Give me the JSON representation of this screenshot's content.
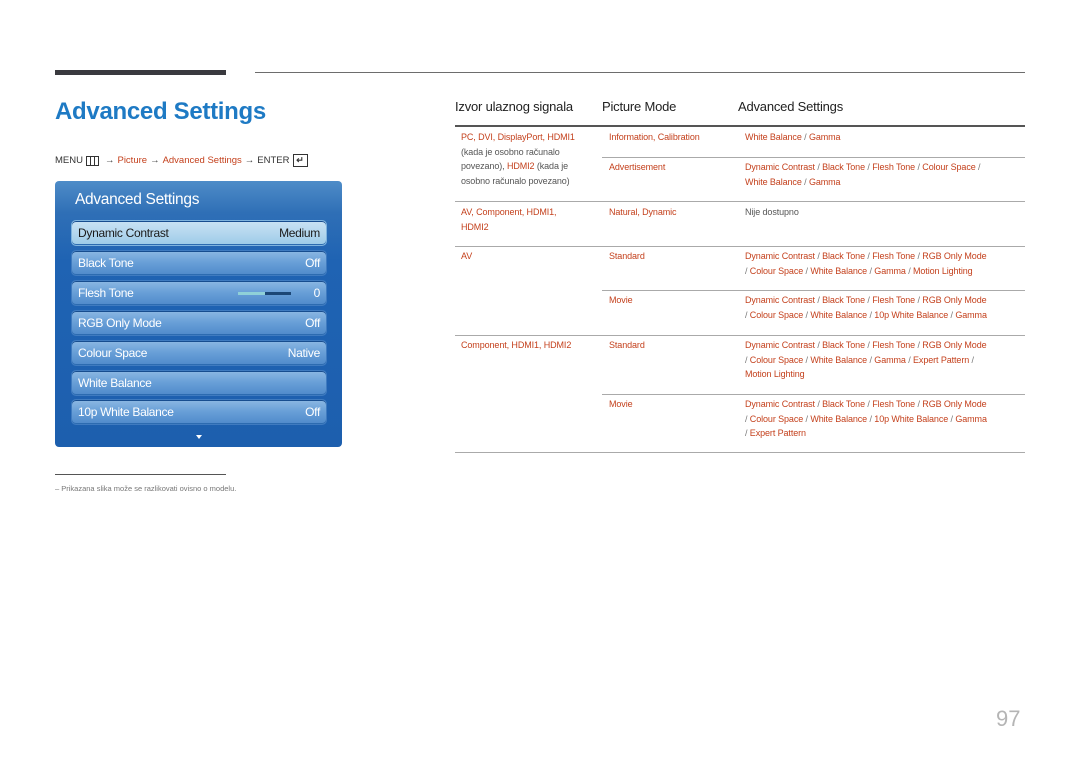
{
  "page_title": "Advanced Settings",
  "breadcrumb": {
    "menu": "MENU",
    "menu_icon": "menu-grid-icon",
    "arrow": "→",
    "picture": "Picture",
    "advanced": "Advanced Settings",
    "enter": "ENTER",
    "enter_icon": "enter-icon",
    "enter_glyph": "↵"
  },
  "osd": {
    "title": "Advanced Settings",
    "items": [
      {
        "label": "Dynamic Contrast",
        "value": "Medium",
        "selected": true
      },
      {
        "label": "Black Tone",
        "value": "Off"
      },
      {
        "label": "Flesh Tone",
        "value": "0",
        "slider_fraction": 0.5
      },
      {
        "label": "RGB Only Mode",
        "value": "Off"
      },
      {
        "label": "Colour Space",
        "value": "Native"
      },
      {
        "label": "White Balance",
        "value": ""
      },
      {
        "label": "10p White Balance",
        "value": "Off"
      }
    ],
    "more_icon": "down-arrow-icon"
  },
  "footnote": "–  Prikazana slika može se razlikovati ovisno o modelu.",
  "table": {
    "headers": [
      "Izvor ulaznog signala",
      "Picture Mode",
      "Advanced Settings"
    ],
    "rows": [
      {
        "source": "PC, DVI, DisplayPort, HDMI1",
        "source_note1": "(kada je osobno računalo",
        "source_note2": "povezano),",
        "source_hdmi2": "HDMI2",
        "source_note3": "(kada je",
        "source_note4": "osobno računalo povezano)",
        "mode": "Information, Calibration",
        "settings": [
          "White Balance / Gamma"
        ]
      },
      {
        "source": "",
        "mode": "Advertisement",
        "settings": [
          "Dynamic Contrast / Black Tone / Flesh Tone / Colour Space /",
          "White Balance / Gamma"
        ]
      },
      {
        "source": "AV, Component, HDMI1,",
        "source2": "HDMI2",
        "mode": "Natural, Dynamic",
        "settings": [
          "Nije dostupno"
        ]
      },
      {
        "source": "AV",
        "mode": "Standard",
        "settings": [
          "Dynamic Contrast / Black Tone / Flesh Tone / RGB Only Mode",
          "/ Colour Space / White Balance / Gamma / Motion Lighting"
        ]
      },
      {
        "source": "",
        "mode": "Movie",
        "settings": [
          "Dynamic Contrast / Black Tone / Flesh Tone / RGB Only Mode",
          "/ Colour Space / White Balance / 10p White Balance / Gamma"
        ]
      },
      {
        "source": "Component, HDMI1, HDMI2",
        "mode": "Standard",
        "settings": [
          "Dynamic Contrast / Black Tone / Flesh Tone / RGB Only Mode",
          "/ Colour Space / White Balance / Gamma / Expert Pattern /",
          "Motion Lighting"
        ]
      },
      {
        "source": "",
        "mode": "Movie",
        "settings": [
          "Dynamic Contrast / Black Tone / Flesh Tone / RGB Only Mode",
          "/ Colour Space / White Balance / 10p White Balance / Gamma",
          "/ Expert Pattern"
        ]
      }
    ]
  },
  "page_number": "97",
  "colors": {
    "accent_title": "#1e7ac4",
    "link_red": "#c4411d",
    "osd_blue": "#1d5fae"
  }
}
